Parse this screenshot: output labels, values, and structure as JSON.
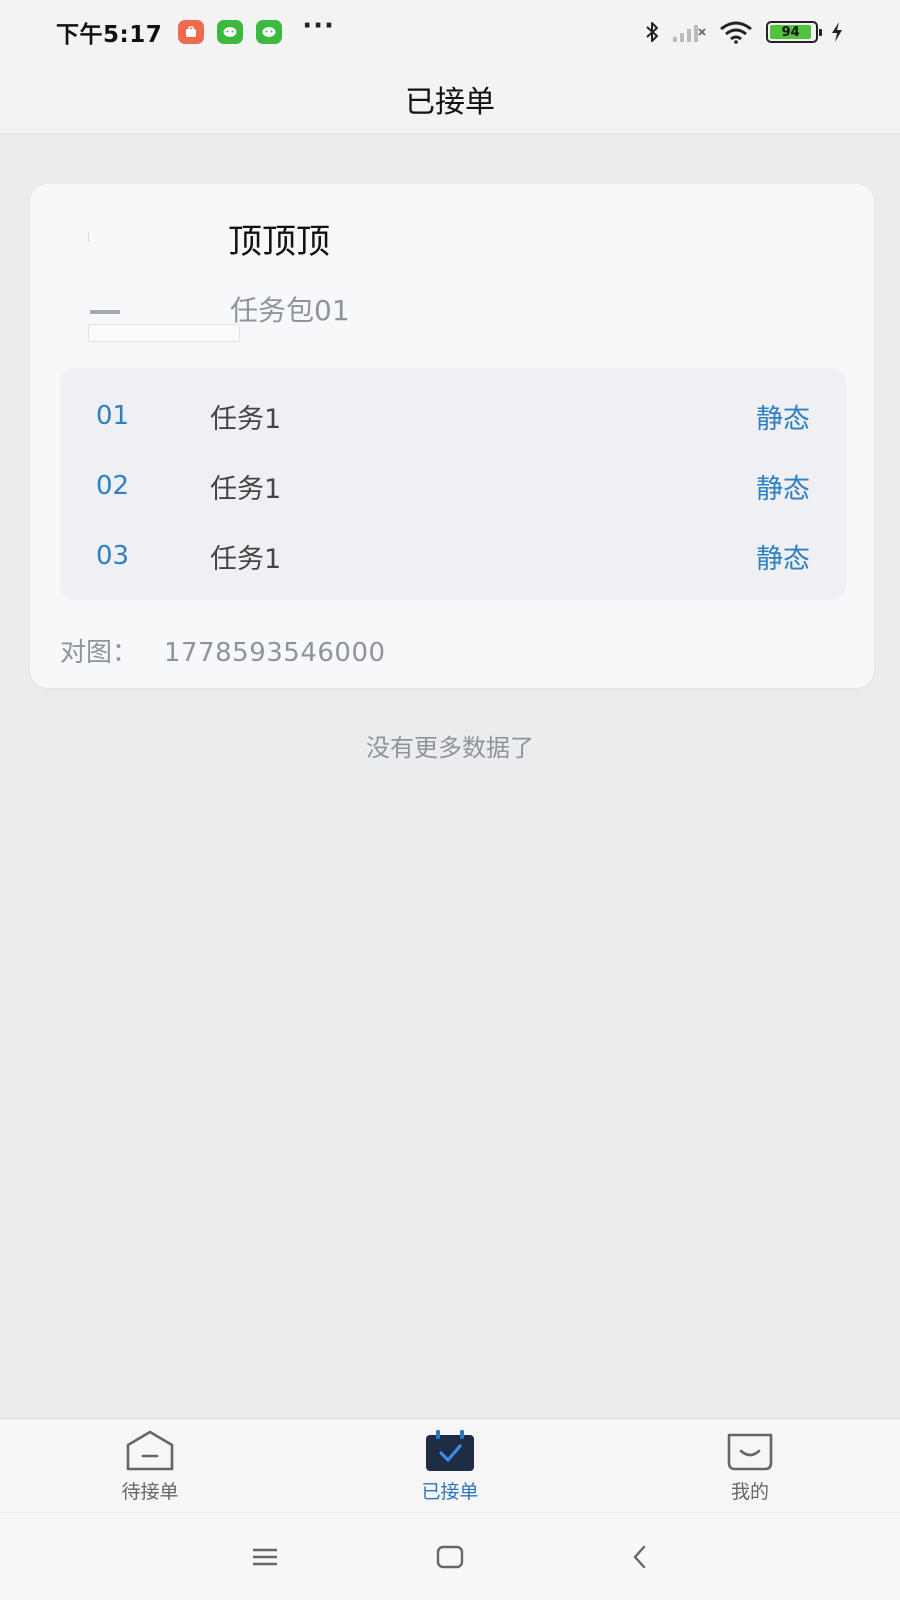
{
  "status_bar": {
    "time": "下午5:17",
    "battery": "94",
    "more": "···"
  },
  "header": {
    "title": "已接单"
  },
  "card": {
    "title": "顶顶顶",
    "subtitle": "任务包01",
    "tasks": [
      {
        "num": "01",
        "name": "任务1",
        "status": "静态"
      },
      {
        "num": "02",
        "name": "任务1",
        "status": "静态"
      },
      {
        "num": "03",
        "name": "任务1",
        "status": "静态"
      }
    ],
    "footer_label": "对图：",
    "footer_value": "1778593546000"
  },
  "list_end_text": "没有更多数据了",
  "tab_bar": {
    "tabs": [
      {
        "label": "待接单",
        "icon": "inbox-icon"
      },
      {
        "label": "已接单",
        "icon": "calendar-check-icon"
      },
      {
        "label": "我的",
        "icon": "smile-icon"
      }
    ],
    "active_index": 1
  },
  "colors": {
    "accent": "#2c74c0",
    "battery_fill": "#4fc43c",
    "app_badge_orange": "#ee6b4d",
    "app_badge_green": "#3cba3f"
  }
}
